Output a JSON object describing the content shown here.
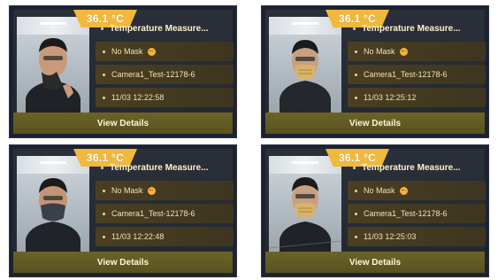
{
  "cards": [
    {
      "temperature": "36.1 °C",
      "title": "Temperature Measure...",
      "mask_status": "No Mask",
      "camera": "Camera1_Test-12178-6",
      "timestamp": "11/03 12:22:58",
      "details_label": "View Details"
    },
    {
      "temperature": "36.1 °C",
      "title": "Temperature Measure...",
      "mask_status": "No Mask",
      "camera": "Camera1_Test-12178-6",
      "timestamp": "11/03 12:25:12",
      "details_label": "View Details"
    },
    {
      "temperature": "36.1 °C",
      "title": "Temperature Measure...",
      "mask_status": "No Mask",
      "camera": "Camera1_Test-12178-6",
      "timestamp": "11/03 12:22:48",
      "details_label": "View Details"
    },
    {
      "temperature": "36.1 °C",
      "title": "Temperature Measure...",
      "mask_status": "No Mask",
      "camera": "Camera1_Test-12178-6",
      "timestamp": "11/03 12:25:03",
      "details_label": "View Details"
    }
  ],
  "colors": {
    "temperature_badge": "#f2b83c",
    "card_background": "#23282f",
    "info_row": "#4a3f22",
    "details_button": "#6b6428",
    "text_accent": "#f1e2b3",
    "mask_status_icon": "#f6b23a"
  },
  "icons": {
    "mask_status": "face-icon"
  }
}
